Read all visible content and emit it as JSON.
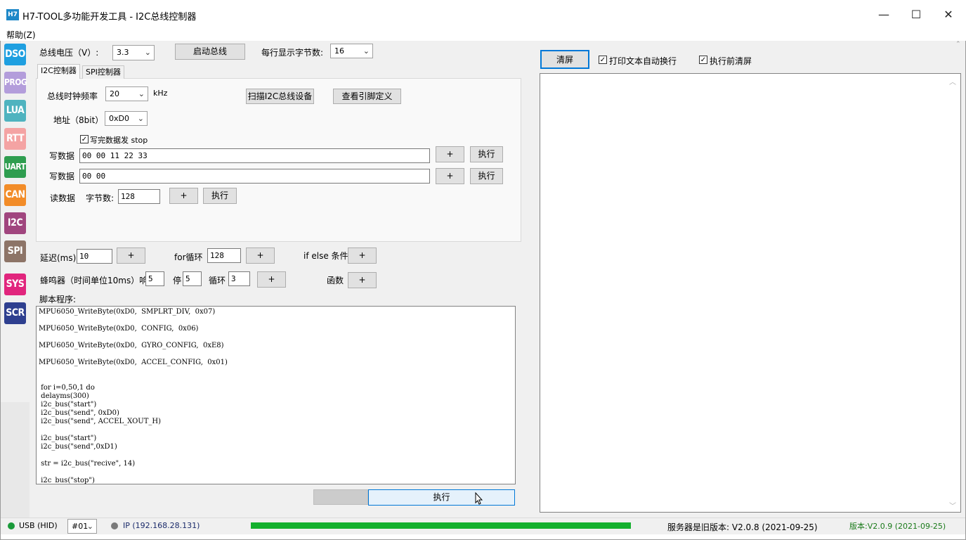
{
  "window": {
    "app_icon": "H7",
    "title": "H7-TOOL多功能开发工具 - I2C总线控制器",
    "minimize": "—",
    "maximize": "☐",
    "close": "✕"
  },
  "menu": {
    "help": "帮助(Z)"
  },
  "sidebar": [
    {
      "label": "DSO",
      "color": "#1f9fe0"
    },
    {
      "label": "PROG",
      "color": "#b39ddb"
    },
    {
      "label": "LUA",
      "color": "#4fb3bf"
    },
    {
      "label": "RTT",
      "color": "#f4a3a3"
    },
    {
      "label": "UART",
      "color": "#2e9d4f"
    },
    {
      "label": "CAN",
      "color": "#f28c28"
    },
    {
      "label": "I2C",
      "color": "#a0457e"
    },
    {
      "label": "SPI",
      "color": "#8d7467"
    },
    {
      "label": "SYS",
      "color": "#e1257d"
    },
    {
      "label": "SCR",
      "color": "#2e3f8f"
    }
  ],
  "top": {
    "voltage_label": "总线电压（V）:",
    "voltage_value": "3.3",
    "start_bus_button": "启动总线",
    "bytes_per_line_label": "每行显示字节数:",
    "bytes_per_line_value": "16"
  },
  "tabs": [
    "I2C控制器",
    "SPI控制器"
  ],
  "i2c": {
    "clock_label": "总线时钟频率",
    "clock_value": "20",
    "clock_unit": "kHz",
    "scan_button": "扫描I2C总线设备",
    "pinout_button": "查看引脚定义",
    "address_label": "地址（8bit）",
    "address_value": "0xD0",
    "stop_checkbox": "写完数据发 stop",
    "write1_label": "写数据",
    "write1_value": "00 00 11 22 33",
    "write2_label": "写数据",
    "write2_value": "00 00",
    "plus": "+",
    "execute": "执行",
    "read_label": "读数据",
    "byte_count_label": "字节数:",
    "byte_count_value": "128"
  },
  "snippets": {
    "delay_label": "延迟(ms)",
    "delay_value": "10",
    "for_label": "for循环",
    "for_value": "128",
    "ifelse_label": "if else 条件",
    "beep_label": "蜂鸣器（时间单位10ms）响",
    "beep_on": "5",
    "stop_label": "停",
    "beep_off": "5",
    "loop_label": "循环",
    "loop_value": "3",
    "func_label": "函数",
    "plus": "+"
  },
  "script": {
    "label": "脚本程序:",
    "lines": [
      "MPU6050_WriteByte(0xD0,  SMPLRT_DIV,  0x07)",
      "",
      "MPU6050_WriteByte(0xD0,  CONFIG,  0x06)",
      "",
      "MPU6050_WriteByte(0xD0,  GYRO_CONFIG,  0xE8)",
      "",
      "MPU6050_WriteByte(0xD0,  ACCEL_CONFIG,  0x01)",
      "",
      "",
      " for i=0,50,1 do",
      " delayms(300)",
      " i2c_bus(\"start\")",
      " i2c_bus(\"send\", 0xD0)",
      " i2c_bus(\"send\", ACCEL_XOUT_H)",
      "",
      " i2c_bus(\"start\")",
      " i2c_bus(\"send\",0xD1)",
      "",
      " str = i2c_bus(\"recive\", 14)",
      "",
      " i2c_bus(\"stop\")"
    ],
    "execute_button": "执行"
  },
  "right": {
    "clear_button": "清屏",
    "wrap_checkbox": "打印文本自动换行",
    "clear_before_checkbox": "执行前清屏"
  },
  "status": {
    "usb": "USB (HID)",
    "device": "#01",
    "ip": "IP (192.168.28.131)",
    "progress": 1.0,
    "server_version": "服务器是旧版本: V2.0.8 (2021-09-25)",
    "version": "版本:V2.0.9 (2021-09-25)",
    "usb_color": "#1a9a3a",
    "ip_color": "#7a7a7a",
    "progress_color": "#14b02e",
    "version_color": "#1a7a1a"
  }
}
